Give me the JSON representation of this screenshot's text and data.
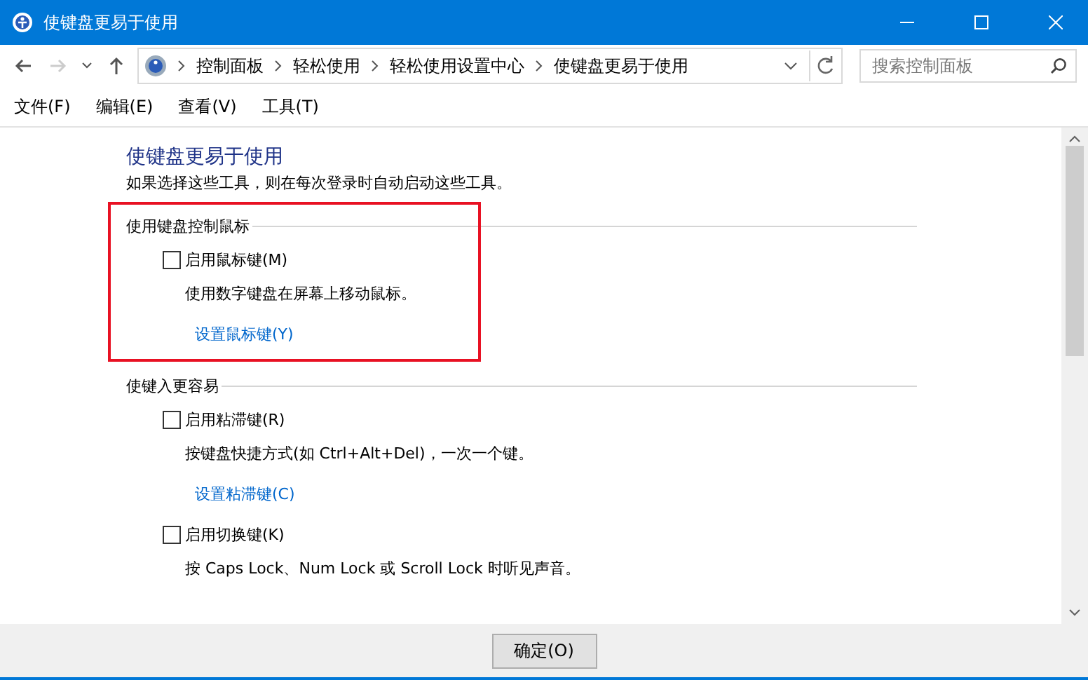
{
  "window": {
    "title": "使键盘更易于使用"
  },
  "nav": {
    "back_disabled": false,
    "forward_disabled": true,
    "breadcrumbs": [
      "控制面板",
      "轻松使用",
      "轻松使用设置中心",
      "使键盘更易于使用"
    ],
    "search": {
      "placeholder": "搜索控制面板"
    }
  },
  "menu": [
    "文件(F)",
    "编辑(E)",
    "查看(V)",
    "工具(T)"
  ],
  "page": {
    "heading": "使键盘更易于使用",
    "description": "如果选择这些工具，则在每次登录时自动启动这些工具。"
  },
  "sections": [
    {
      "title": "使用键盘控制鼠标",
      "highlighted": true,
      "options": [
        {
          "label": "启用鼠标键(M)",
          "checked": false,
          "description": "使用数字键盘在屏幕上移动鼠标。",
          "link": "设置鼠标键(Y)"
        }
      ]
    },
    {
      "title": "使键入更容易",
      "highlighted": false,
      "options": [
        {
          "label": "启用粘滞键(R)",
          "checked": false,
          "description": "按键盘快捷方式(如 Ctrl+Alt+Del)，一次一个键。",
          "link": "设置粘滞键(C)"
        },
        {
          "label": "启用切换键(K)",
          "checked": false,
          "description": "按 Caps Lock、Num Lock 或 Scroll Lock 时听见声音。"
        }
      ]
    }
  ],
  "footer": {
    "ok_button": "确定(O)"
  }
}
